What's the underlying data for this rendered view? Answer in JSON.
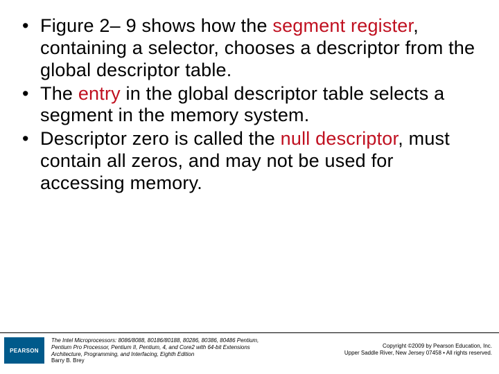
{
  "bullets": [
    {
      "pre": "Figure 2– 9 shows how the ",
      "hl": "segment register",
      "post": ", containing a selector, chooses a descriptor from the global descriptor table."
    },
    {
      "pre": "The ",
      "hl": "entry",
      "post": " in the global descriptor table selects a segment in the memory system."
    },
    {
      "pre": "Descriptor zero is called the ",
      "hl": "null descriptor",
      "post": ", must contain all zeros, and may not be used for accessing memory."
    }
  ],
  "footer": {
    "logo": "PEARSON",
    "book_line1": "The Intel Microprocessors: 8086/8088, 80186/80188, 80286, 80386, 80486 Pentium,",
    "book_line2": "Pentium Pro Processor, Pentium II, Pentium, 4, and Core2 with 64-bit Extensions",
    "book_line3": "Architecture, Programming, and Interfacing, Eighth Edition",
    "author": "Barry B. Brey",
    "copyright_line1": "Copyright ©2009 by Pearson Education, Inc.",
    "copyright_line2": "Upper Saddle River, New Jersey 07458 • All rights reserved."
  }
}
